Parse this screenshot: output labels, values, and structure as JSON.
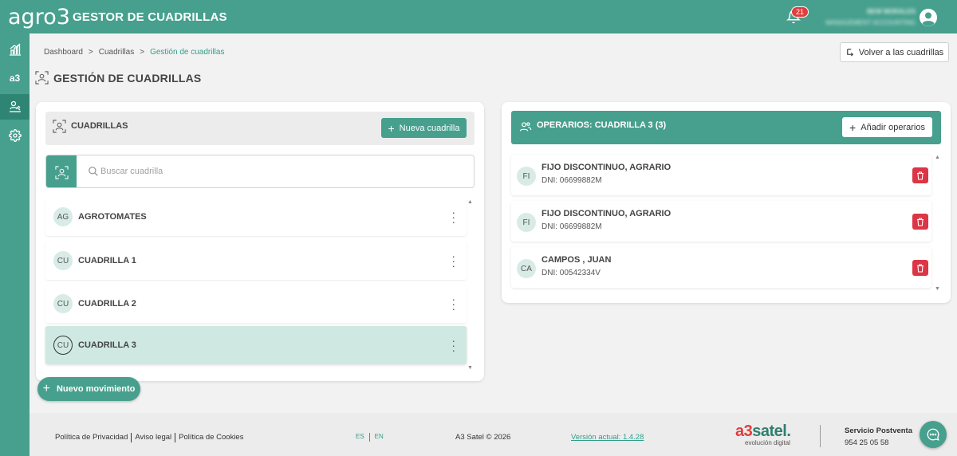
{
  "app": {
    "logo": "agro3",
    "title": "GESTOR DE CUADRILLAS",
    "notifications_count": "21",
    "user_name": "BEW MORALES",
    "user_role": "MANAGEMENT ACCOUNTING"
  },
  "sidebar": {
    "items": [
      {
        "icon": "chart-icon"
      },
      {
        "icon": "a3-icon",
        "label": "a3"
      },
      {
        "icon": "workers-icon",
        "active": true
      },
      {
        "icon": "gear-icon"
      }
    ]
  },
  "breadcrumb": [
    "Dashboard",
    ">",
    "Cuadrillas",
    ">",
    "Gestión de cuadrillas"
  ],
  "back_button": "Volver a las cuadrillas",
  "page_title": "GESTIÓN DE CUADRILLAS",
  "cuadrillas": {
    "title": "CUADRILLAS",
    "new_button": "Nueva cuadrilla",
    "search_placeholder": "Buscar cuadrilla",
    "items": [
      {
        "initials": "AG",
        "name": "AGROTOMATES"
      },
      {
        "initials": "CU",
        "name": "CUADRILLA 1"
      },
      {
        "initials": "CU",
        "name": "CUADRILLA 2"
      },
      {
        "initials": "CU",
        "name": "CUADRILLA 3",
        "selected": true
      }
    ]
  },
  "new_movement_button": "Nuevo movimiento",
  "operarios": {
    "title": "OPERARIOS: CUADRILLA 3 (3)",
    "add_button": "Añadir operarios",
    "items": [
      {
        "initials": "FI",
        "name": "FIJO DISCONTINUO, AGRARIO",
        "dni": "DNI: 06699882M"
      },
      {
        "initials": "FI",
        "name": "FIJO DISCONTINUO, AGRARIO",
        "dni": "DNI: 06699882M"
      },
      {
        "initials": "CA",
        "name": "CAMPOS , JUAN",
        "dni": "DNI: 00542334V"
      }
    ]
  },
  "footer": {
    "privacy": "Política de Privacidad",
    "legal": "Aviso legal",
    "cookies": "Política de Cookies",
    "lang_es": "ES",
    "lang_en": "EN",
    "copyright": "A3 Satel © 2026",
    "version": "Versión actual: 1.4.28",
    "brand_a3": "a3",
    "brand_rest": "satel.",
    "brand_sub": "evolución digital",
    "support_title": "Servicio Postventa",
    "support_phone": "954 25 05 58"
  },
  "colors": {
    "primary": "#46a08d",
    "primary_dark": "#2f8574",
    "selected_row": "#cfe9e2",
    "danger": "#dc3545"
  }
}
